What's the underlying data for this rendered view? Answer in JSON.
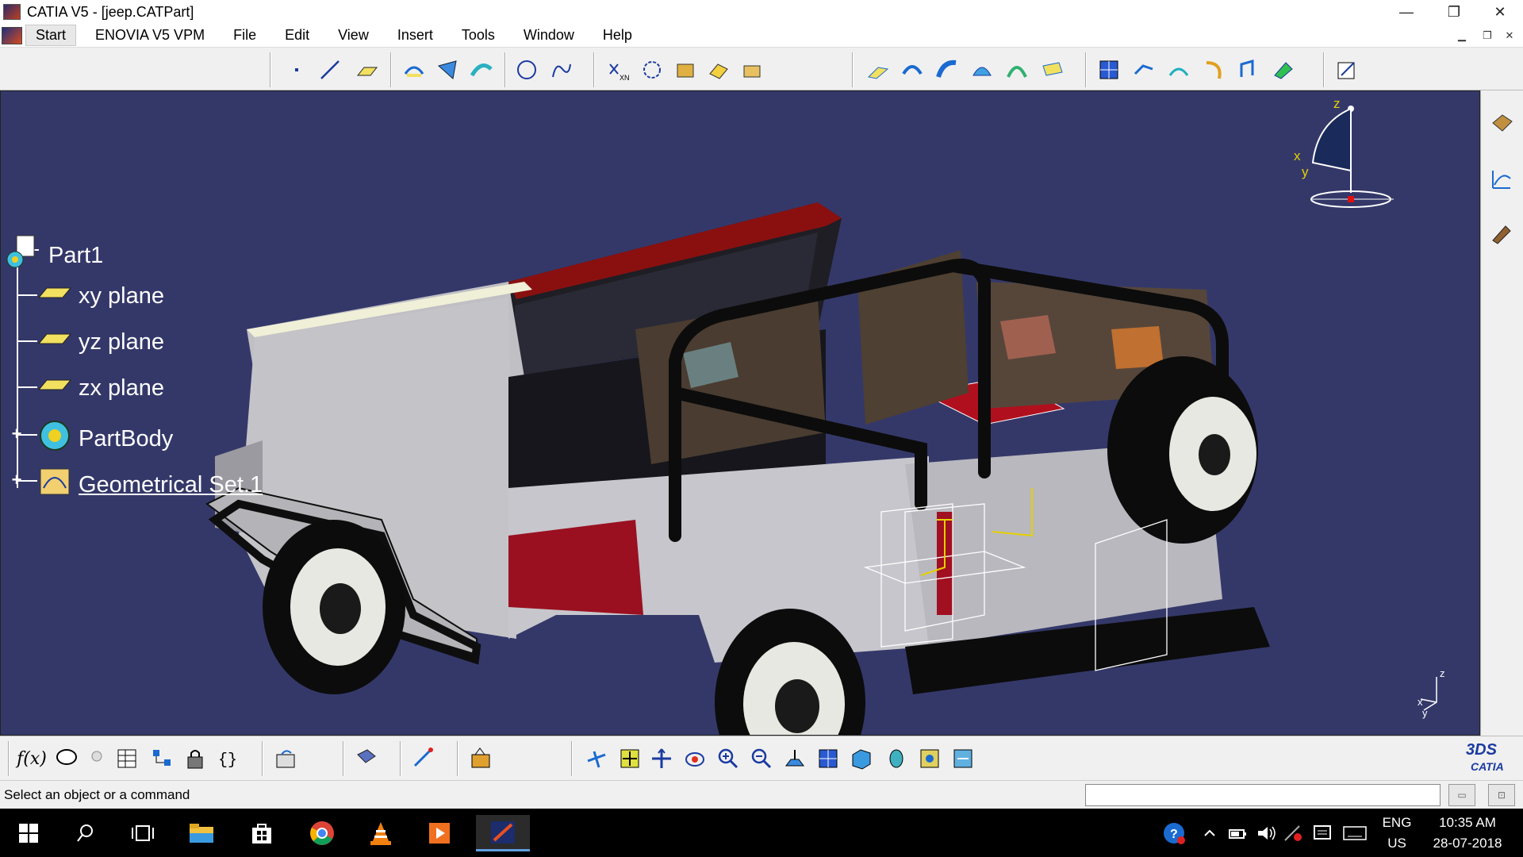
{
  "window": {
    "title": "CATIA V5 - [jeep.CATPart]",
    "minimize": "—",
    "restore": "❐",
    "close": "✕"
  },
  "menu": {
    "items": [
      "Start",
      "ENOVIA V5 VPM",
      "File",
      "Edit",
      "View",
      "Insert",
      "Tools",
      "Window",
      "Help"
    ]
  },
  "tree": {
    "root": "Part1",
    "items": [
      {
        "label": "xy plane",
        "icon": "plane-icon"
      },
      {
        "label": "yz plane",
        "icon": "plane-icon"
      },
      {
        "label": "zx plane",
        "icon": "plane-icon"
      },
      {
        "label": "PartBody",
        "icon": "partbody-icon"
      },
      {
        "label": "Geometrical Set.1",
        "icon": "geometrical-set-icon"
      }
    ]
  },
  "compass": {
    "z": "z",
    "x": "x",
    "y": "y"
  },
  "axis_triad": {
    "z": "z",
    "x": "x",
    "y": "y"
  },
  "status": {
    "prompt": "Select an object or a command",
    "command_input": ""
  },
  "taskbar": {
    "language": "ENG",
    "region": "US",
    "time": "10:35 AM",
    "date": "28-07-2018"
  },
  "brand": {
    "logo_text": "CATIA",
    "logo_mark": "3DS"
  },
  "colors": {
    "viewport_bg": "#343869",
    "jeep_body": "#c8c8cc",
    "jeep_red": "#a01020",
    "tire": "#111111"
  }
}
